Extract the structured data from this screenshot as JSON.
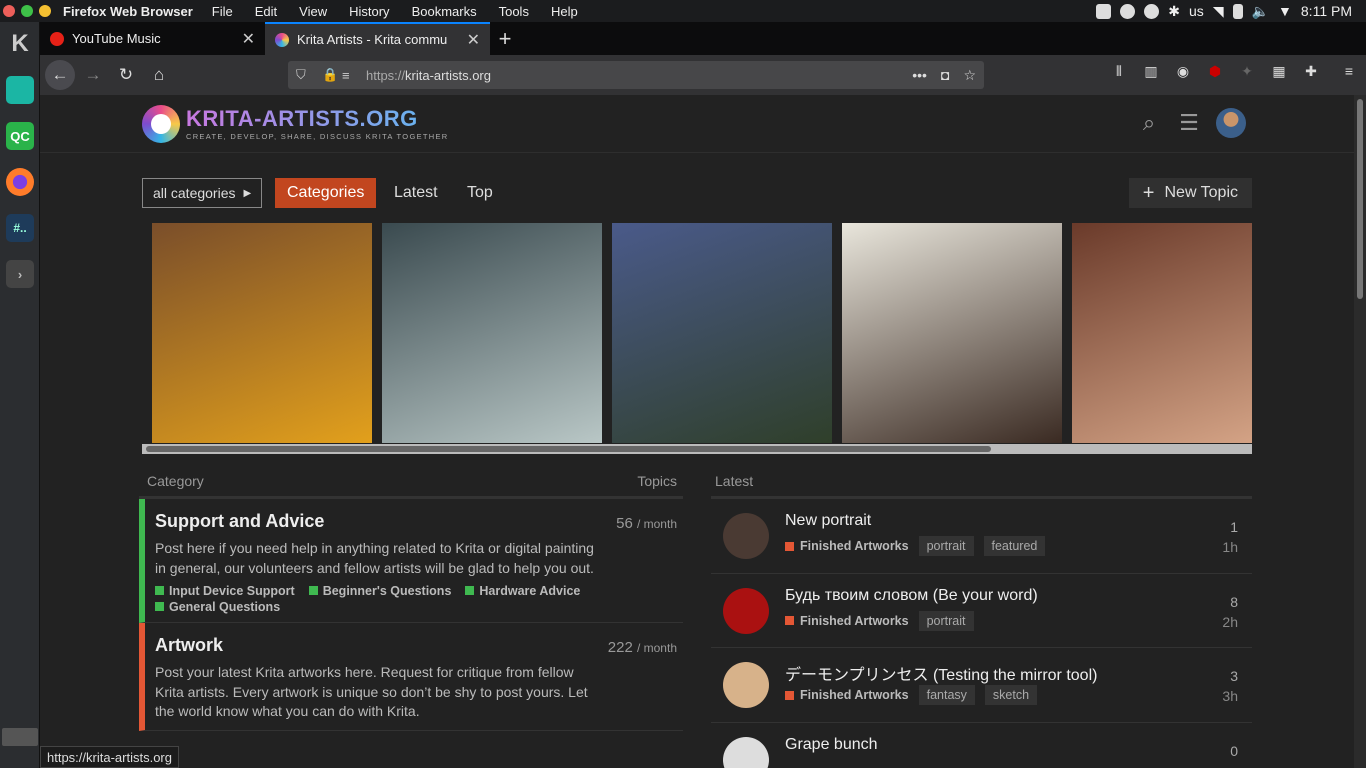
{
  "system": {
    "app_name": "Firefox Web Browser",
    "menu": [
      "File",
      "Edit",
      "View",
      "History",
      "Bookmarks",
      "Tools",
      "Help"
    ],
    "keyboard": "us",
    "clock": "8:11 PM"
  },
  "dock": {
    "items": [
      {
        "name": "kde-launcher-icon",
        "glyph": "K"
      },
      {
        "name": "files-icon",
        "glyph": ""
      },
      {
        "name": "qc-icon",
        "glyph": "QC"
      },
      {
        "name": "firefox-icon",
        "glyph": ""
      },
      {
        "name": "terminal-icon",
        "glyph": "#.."
      },
      {
        "name": "expand-icon",
        "glyph": ">"
      }
    ]
  },
  "tabs": [
    {
      "title": "YouTube Music",
      "active": false,
      "favicon_color": "#e62117"
    },
    {
      "title": "Krita Artists - Krita commu",
      "active": true,
      "favicon_color": "#5aa4d8"
    }
  ],
  "url": {
    "scheme": "https://",
    "host": "krita-artists.org"
  },
  "site": {
    "logo_title": "KRITA-ARTISTS.ORG",
    "logo_tagline": "CREATE, DEVELOP, SHARE, DISCUSS KRITA TOGETHER",
    "all_categories": "all categories",
    "nav": [
      "Categories",
      "Latest",
      "Top"
    ],
    "new_topic": "New Topic"
  },
  "gallery": [
    {
      "name": "portrait-yellow-artwork",
      "colors": [
        "#7a4e2a",
        "#e2a01c"
      ]
    },
    {
      "name": "snowy-bridge-artwork",
      "colors": [
        "#3a4a4f",
        "#b9c7c6"
      ]
    },
    {
      "name": "mountain-castle-artwork",
      "colors": [
        "#4a5a8a",
        "#2f3f2a"
      ]
    },
    {
      "name": "sleeping-girl-artwork",
      "colors": [
        "#e9e6dc",
        "#3a2a22"
      ]
    },
    {
      "name": "robot-explosion-artwork",
      "colors": [
        "#6a3a2a",
        "#d9a88a"
      ]
    }
  ],
  "categories": {
    "header_category": "Category",
    "header_topics": "Topics",
    "items": [
      {
        "name": "Support and Advice",
        "count": "56",
        "period": "/ month",
        "color": "#3fb950",
        "description": "Post here if you need help in anything related to Krita or digital painting in general, our volunteers and fellow artists will be glad to help you out.",
        "subcategories": [
          "Input Device Support",
          "Beginner's Questions",
          "Hardware Advice",
          "General Questions"
        ]
      },
      {
        "name": "Artwork",
        "count": "222",
        "period": "/ month",
        "color": "#e45735",
        "description": "Post your latest Krita artworks here. Request for critique from fellow Krita artists. Every artwork is unique so don’t be shy to post yours. Let the world know what you can do with Krita.",
        "subcategories": []
      }
    ]
  },
  "latest": {
    "header": "Latest",
    "topics": [
      {
        "title": "New portrait",
        "category": "Finished Artworks",
        "tags": [
          "portrait",
          "featured"
        ],
        "replies": "1",
        "age": "1h",
        "avatar_color": "#4a3a33"
      },
      {
        "title": "Будь твоим словом (Be your word)",
        "category": "Finished Artworks",
        "tags": [
          "portrait"
        ],
        "replies": "8",
        "age": "2h",
        "avatar_color": "#a11"
      },
      {
        "title": "デーモンプリンセス (Testing the mirror tool)",
        "category": "Finished Artworks",
        "tags": [
          "fantasy",
          "sketch"
        ],
        "replies": "3",
        "age": "3h",
        "avatar_color": "#d7b28a"
      },
      {
        "title": "Grape bunch",
        "category": "",
        "tags": [],
        "replies": "0",
        "age": "",
        "avatar_color": "#ddd"
      }
    ]
  },
  "status_url": "https://krita-artists.org"
}
